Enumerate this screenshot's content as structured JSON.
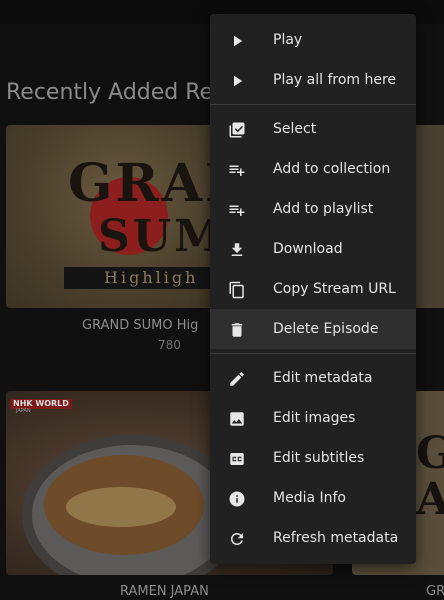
{
  "section": {
    "title": "Recently Added Rec"
  },
  "cards": [
    {
      "caption": "GRAND SUMO Hig",
      "subtitle": "780"
    },
    {
      "caption": "RAMEN JAPAN"
    },
    {
      "caption": "GR"
    }
  ],
  "thumbs": {
    "sumo_line1": "GRAN",
    "sumo_line2": "SUM",
    "sumo_bar": "Highligh",
    "nhk_badge": "NHK WORLD",
    "nhk_sub": "JAPAN",
    "right_mark": "G\nA"
  },
  "menu": {
    "items": [
      {
        "label": "Play",
        "icon": "play-icon"
      },
      {
        "label": "Play all from here",
        "icon": "play-icon"
      },
      {
        "label": "Select",
        "icon": "checkbox-multiple-icon"
      },
      {
        "label": "Add to collection",
        "icon": "playlist-add-icon"
      },
      {
        "label": "Add to playlist",
        "icon": "playlist-add-icon"
      },
      {
        "label": "Download",
        "icon": "download-icon"
      },
      {
        "label": "Copy Stream URL",
        "icon": "copy-icon"
      },
      {
        "label": "Delete Episode",
        "icon": "trash-icon"
      },
      {
        "label": "Edit metadata",
        "icon": "pencil-icon"
      },
      {
        "label": "Edit images",
        "icon": "image-icon"
      },
      {
        "label": "Edit subtitles",
        "icon": "subtitles-icon"
      },
      {
        "label": "Media Info",
        "icon": "info-icon"
      },
      {
        "label": "Refresh metadata",
        "icon": "refresh-icon"
      }
    ],
    "highlighted": "Delete Episode"
  },
  "colors": {
    "background": "#101010",
    "menu": "#212121",
    "menu_highlight": "#2f2f2f",
    "text": "#e4e4e4"
  }
}
